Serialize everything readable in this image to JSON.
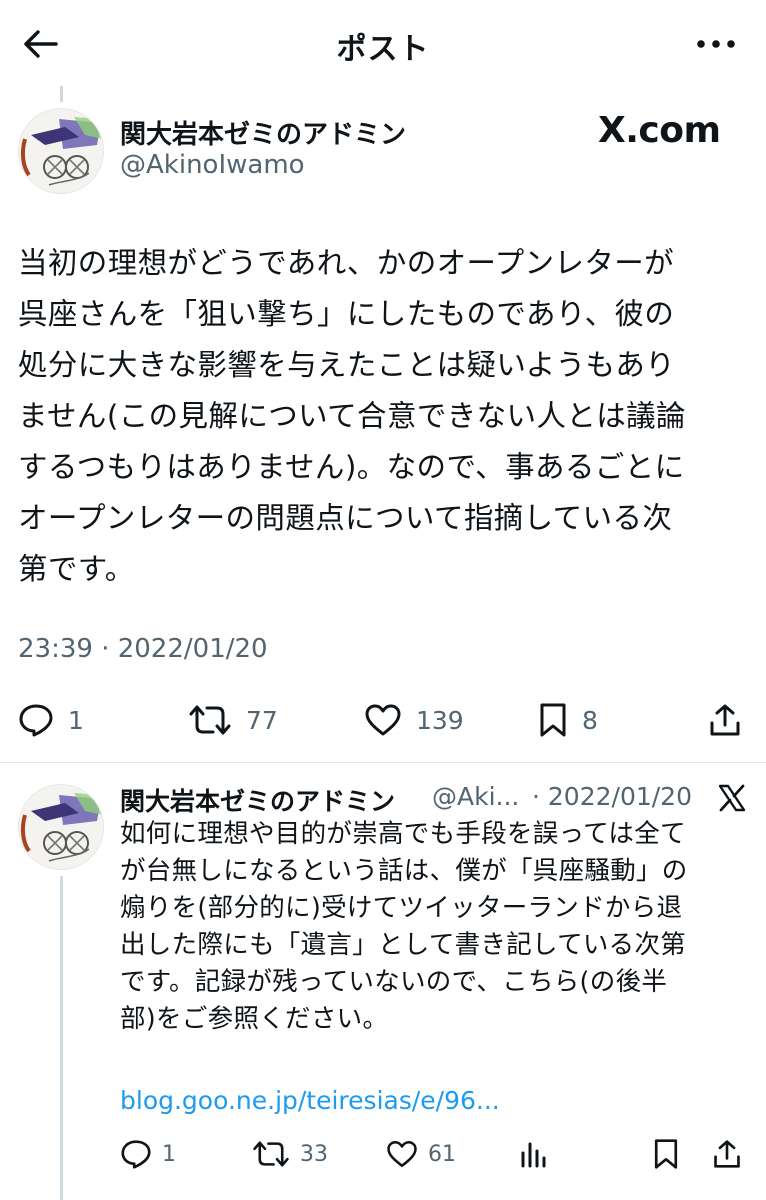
{
  "header": {
    "title": "ポスト",
    "back_icon": "arrow-left-icon",
    "more_icon": "more-horizontal-icon"
  },
  "main_post": {
    "author_name": "関大岩本ゼミのアドミン",
    "author_handle": "@AkinoIwamo",
    "source_badge": "X.com",
    "text": "当初の理想がどうであれ、かのオープンレターが\n呉座さんを「狙い撃ち」にしたものであり、彼の\n処分に大きな影響を与えたことは疑いようもあり\nません(この見解について合意できない人とは議論\nするつもりはありません)。なので、事あるごとに\nオープンレターの問題点について指摘している次\n第です。",
    "timestamp": "23:39 · 2022/01/20",
    "stats": {
      "replies": "1",
      "reposts": "77",
      "likes": "139",
      "bookmarks": "8"
    }
  },
  "reply_post": {
    "author_name": "関大岩本ゼミのアドミン",
    "author_handle": "@Aki...",
    "separator": "·",
    "date": "2022/01/20",
    "text": "如何に理想や目的が崇高でも手段を誤っては全て\nが台無しになるという話は、僕が「呉座騒動」の\n煽りを(部分的に)受けてツイッターランドから退\n出した際にも「遺言」として書き記している次第\nです。記録が残っていないので、こちら(の後半\n部)をご参照ください。",
    "link": "blog.goo.ne.jp/teiresias/e/96...",
    "stats": {
      "replies": "1",
      "reposts": "33",
      "likes": "61"
    }
  },
  "colors": {
    "text": "#0f1419",
    "secondary": "#536471",
    "link": "#1d9bf0",
    "divider": "#e1e8ed",
    "thread_line": "#cfd9de"
  }
}
